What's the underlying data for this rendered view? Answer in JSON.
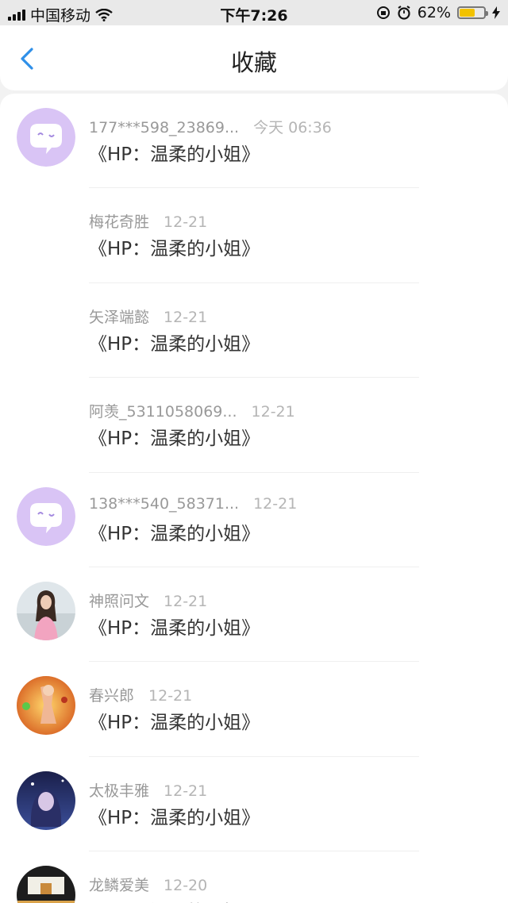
{
  "status_bar": {
    "carrier": "中国移动",
    "time": "下午7:26",
    "battery": "62%",
    "battery_level": 0.62
  },
  "nav": {
    "title": "收藏",
    "back_icon": "chevron-left-icon"
  },
  "items": [
    {
      "user": "177***598_23869...",
      "time": "今天 06:36",
      "title": "《HP：温柔的小姐》",
      "avatar": "default-chat"
    },
    {
      "user": "梅花奇胜",
      "time": "12-21",
      "title": "《HP：温柔的小姐》",
      "avatar": "none"
    },
    {
      "user": "矢泽端懿",
      "time": "12-21",
      "title": "《HP：温柔的小姐》",
      "avatar": "none"
    },
    {
      "user": "阿羡_5311058069...",
      "time": "12-21",
      "title": "《HP：温柔的小姐》",
      "avatar": "none"
    },
    {
      "user": "138***540_58371...",
      "time": "12-21",
      "title": "《HP：温柔的小姐》",
      "avatar": "default-chat"
    },
    {
      "user": "神照问文",
      "time": "12-21",
      "title": "《HP：温柔的小姐》",
      "avatar": "photo-girl"
    },
    {
      "user": "春兴郎",
      "time": "12-21",
      "title": "《HP：温柔的小姐》",
      "avatar": "photo-game"
    },
    {
      "user": "太极丰雅",
      "time": "12-21",
      "title": "《HP：温柔的小姐》",
      "avatar": "photo-anime"
    },
    {
      "user": "龙鳞爱美",
      "time": "12-20",
      "title": "《HP：温柔的小姐》",
      "avatar": "photo-room"
    }
  ]
}
